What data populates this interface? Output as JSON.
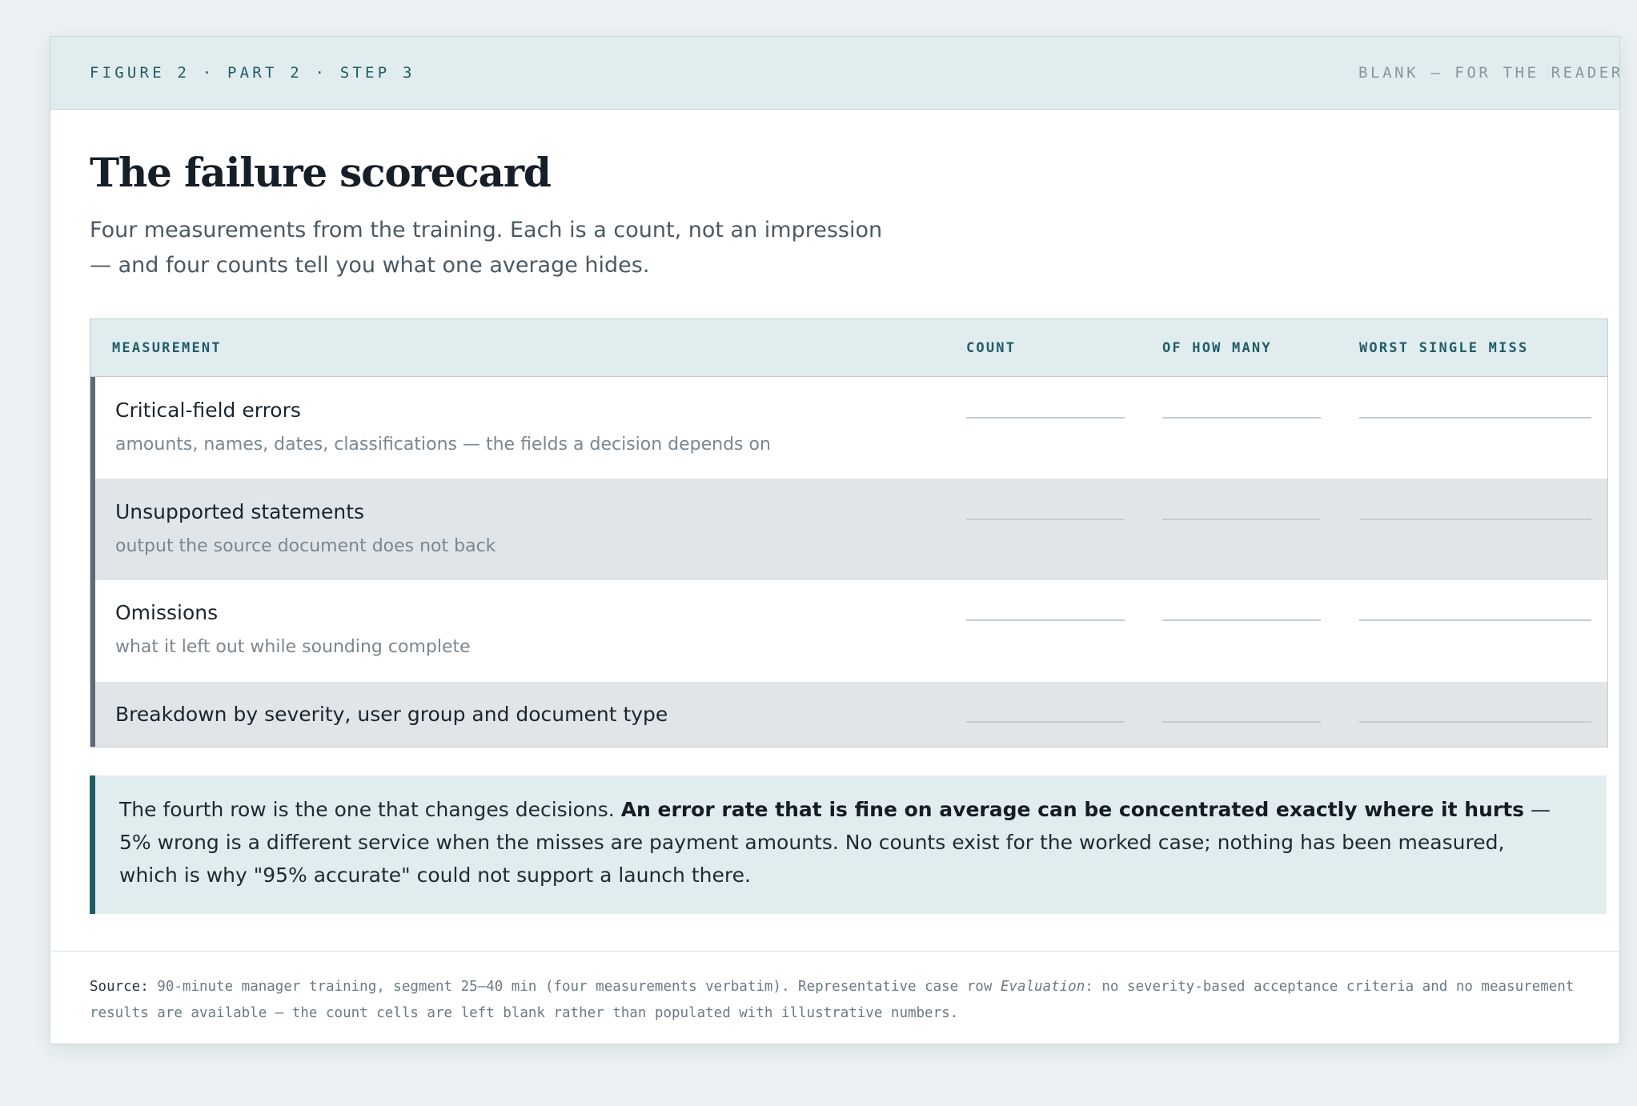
{
  "header": {
    "figure_label": "FIGURE 2 · PART 2 · STEP 3",
    "status_label": "BLANK — FOR THE READER"
  },
  "title": "The failure scorecard",
  "intro": "Four measurements from the training. Each is a count, not an impression — and four counts tell you what one average hides.",
  "table": {
    "columns": [
      "MEASUREMENT",
      "COUNT",
      "OF HOW MANY",
      "WORST SINGLE MISS"
    ],
    "rows": [
      {
        "name": "Critical-field errors",
        "desc": "amounts, names, dates, classifications — the fields a decision depends on",
        "count": "",
        "of_how_many": "",
        "worst_single_miss": ""
      },
      {
        "name": "Unsupported statements",
        "desc": "output the source document does not back",
        "count": "",
        "of_how_many": "",
        "worst_single_miss": ""
      },
      {
        "name": "Omissions",
        "desc": "what it left out while sounding complete",
        "count": "",
        "of_how_many": "",
        "worst_single_miss": ""
      },
      {
        "name": "Breakdown by severity, user group and document type",
        "desc": "",
        "count": "",
        "of_how_many": "",
        "worst_single_miss": ""
      }
    ]
  },
  "callout": {
    "lead": "The fourth row is the one that changes decisions. ",
    "emphasis": "An error rate that is fine on average can be concentrated exactly where it hurts",
    "rest": " — 5% wrong is a different service when the misses are payment amounts. No counts exist for the worked case; nothing has been measured, which is why \"95% accurate\" could not support a launch there."
  },
  "footer": {
    "source_label": "Source:",
    "source_text_a": " 90-minute manager training, segment 25–40 min (four measurements verbatim). Representative case row ",
    "source_italic": "Evaluation",
    "source_text_b": ": no severity-based acceptance criteria and no measurement results are available — the count cells are left blank rather than populated with illustrative numbers."
  }
}
